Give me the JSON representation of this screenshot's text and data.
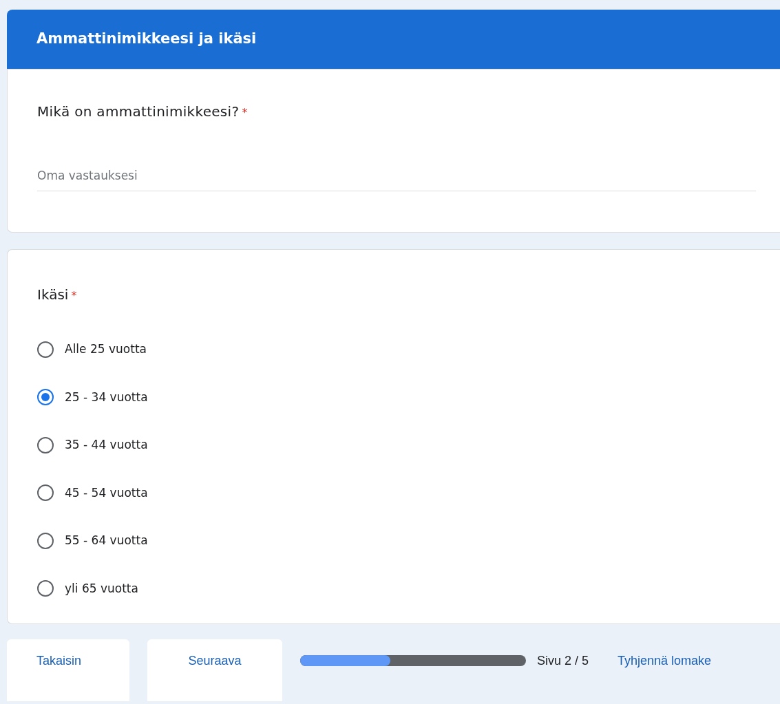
{
  "section": {
    "title": "Ammattinimikkeesi ja ikäsi"
  },
  "questions": [
    {
      "kind": "text",
      "label": "Mikä on ammattinimikkeesi?",
      "required_mark": "*",
      "placeholder": "Oma vastauksesi"
    },
    {
      "kind": "radio",
      "label": "Ikäsi",
      "required_mark": "*",
      "options": [
        {
          "label": "Alle 25 vuotta",
          "selected": false
        },
        {
          "label": "25 - 34 vuotta",
          "selected": true
        },
        {
          "label": "35 - 44 vuotta",
          "selected": false
        },
        {
          "label": "45 - 54 vuotta",
          "selected": false
        },
        {
          "label": "55 - 64 vuotta",
          "selected": false
        },
        {
          "label": "yli 65 vuotta",
          "selected": false
        }
      ]
    }
  ],
  "footer": {
    "back": "Takaisin",
    "next": "Seuraava",
    "progress": {
      "level": 0.4
    },
    "page": "Sivu 2 / 5",
    "clear": "Tyhjennä lomake"
  }
}
